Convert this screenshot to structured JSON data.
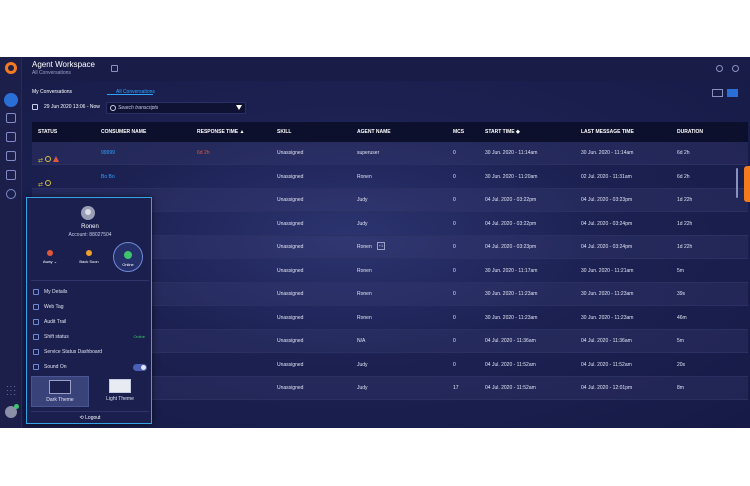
{
  "header": {
    "title": "Agent Workspace",
    "subtitle": "All Conversations"
  },
  "tabs": [
    {
      "label": "My Conversations"
    },
    {
      "label": "All Conversations"
    }
  ],
  "toolbar": {
    "date_range": "29 Jun 2020 13:06 - Now",
    "search_placeholder": "Search transcripts"
  },
  "columns": [
    "STATUS",
    "CONSUMER NAME",
    "RESPONSE TIME",
    "SKILL",
    "AGENT NAME",
    "MCS",
    "START TIME",
    "LAST MESSAGE TIME",
    "DURATION"
  ],
  "sort_asc": "▲",
  "sort_both": "◆",
  "rows": [
    {
      "consumer": "99999",
      "response": "6d 2h",
      "skill": "Unassigned",
      "agent": "superuser",
      "mcs": "0",
      "start": "30 Jun. 2020 - 11:14am",
      "last": "30 Jun. 2020 - 11:14am",
      "duration": "6d 2h"
    },
    {
      "consumer": "Bo Bo",
      "response": "",
      "skill": "Unassigned",
      "agent": "Ronen",
      "mcs": "0",
      "start": "30 Jun. 2020 - 11:20am",
      "last": "02 Jul. 2020 - 11:31am",
      "duration": "6d 2h"
    },
    {
      "consumer": "",
      "response": "",
      "skill": "Unassigned",
      "agent": "Judy",
      "mcs": "0",
      "start": "04 Jul. 2020 - 03:22pm",
      "last": "04 Jul. 2020 - 03:23pm",
      "duration": "1d 22h"
    },
    {
      "consumer": "",
      "response": "",
      "skill": "Unassigned",
      "agent": "Judy",
      "mcs": "0",
      "start": "04 Jul. 2020 - 03:22pm",
      "last": "04 Jul. 2020 - 03:24pm",
      "duration": "1d 22h"
    },
    {
      "consumer": "",
      "response": "",
      "skill": "Unassigned",
      "agent": "Ronen",
      "agent_badge": "+1",
      "mcs": "0",
      "start": "04 Jul. 2020 - 03:23pm",
      "last": "04 Jul. 2020 - 03:24pm",
      "duration": "1d 22h"
    },
    {
      "consumer": "",
      "response": "",
      "skill": "Unassigned",
      "agent": "Ronen",
      "mcs": "0",
      "start": "30 Jun. 2020 - 11:17am",
      "last": "30 Jun. 2020 - 11:21am",
      "duration": "5m"
    },
    {
      "consumer": "",
      "response": "",
      "skill": "Unassigned",
      "agent": "Ronen",
      "mcs": "0",
      "start": "30 Jun. 2020 - 11:23am",
      "last": "30 Jun. 2020 - 11:23am",
      "duration": "39s"
    },
    {
      "consumer": "",
      "response": "",
      "skill": "Unassigned",
      "agent": "Ronen",
      "mcs": "0",
      "start": "30 Jun. 2020 - 11:23am",
      "last": "30 Jun. 2020 - 11:23am",
      "duration": "46m"
    },
    {
      "consumer": "",
      "response": "",
      "skill": "Unassigned",
      "agent": "N/A",
      "mcs": "0",
      "start": "04 Jul. 2020 - 11:36am",
      "last": "04 Jul. 2020 - 11:36am",
      "duration": "5m"
    },
    {
      "consumer": "",
      "response": "",
      "skill": "Unassigned",
      "agent": "Judy",
      "mcs": "0",
      "start": "04 Jul. 2020 - 11:52am",
      "last": "04 Jul. 2020 - 11:52am",
      "duration": "20s"
    },
    {
      "consumer": "",
      "response": "",
      "skill": "Unassigned",
      "agent": "Judy",
      "mcs": "17",
      "start": "04 Jul. 2020 - 11:52am",
      "last": "04 Jul. 2020 - 12:01pm",
      "duration": "8m"
    }
  ],
  "profile": {
    "name": "Ronen",
    "account": "Account: 88027504",
    "states": [
      {
        "label": "Away ⌄",
        "color": "#e0583c"
      },
      {
        "label": "Back Soon",
        "color": "#f0a02a"
      },
      {
        "label": "Online",
        "color": "#3ec46d"
      }
    ],
    "menu": [
      {
        "label": "My Details"
      },
      {
        "label": "Web Tag"
      },
      {
        "label": "Audit Trail"
      },
      {
        "label": "Shift status",
        "status": "Online"
      },
      {
        "label": "Service Status Dashboard"
      },
      {
        "label": "Sound On"
      }
    ],
    "themes": [
      {
        "label": "Dark Theme"
      },
      {
        "label": "Light Theme"
      }
    ],
    "logout": "Logout"
  }
}
